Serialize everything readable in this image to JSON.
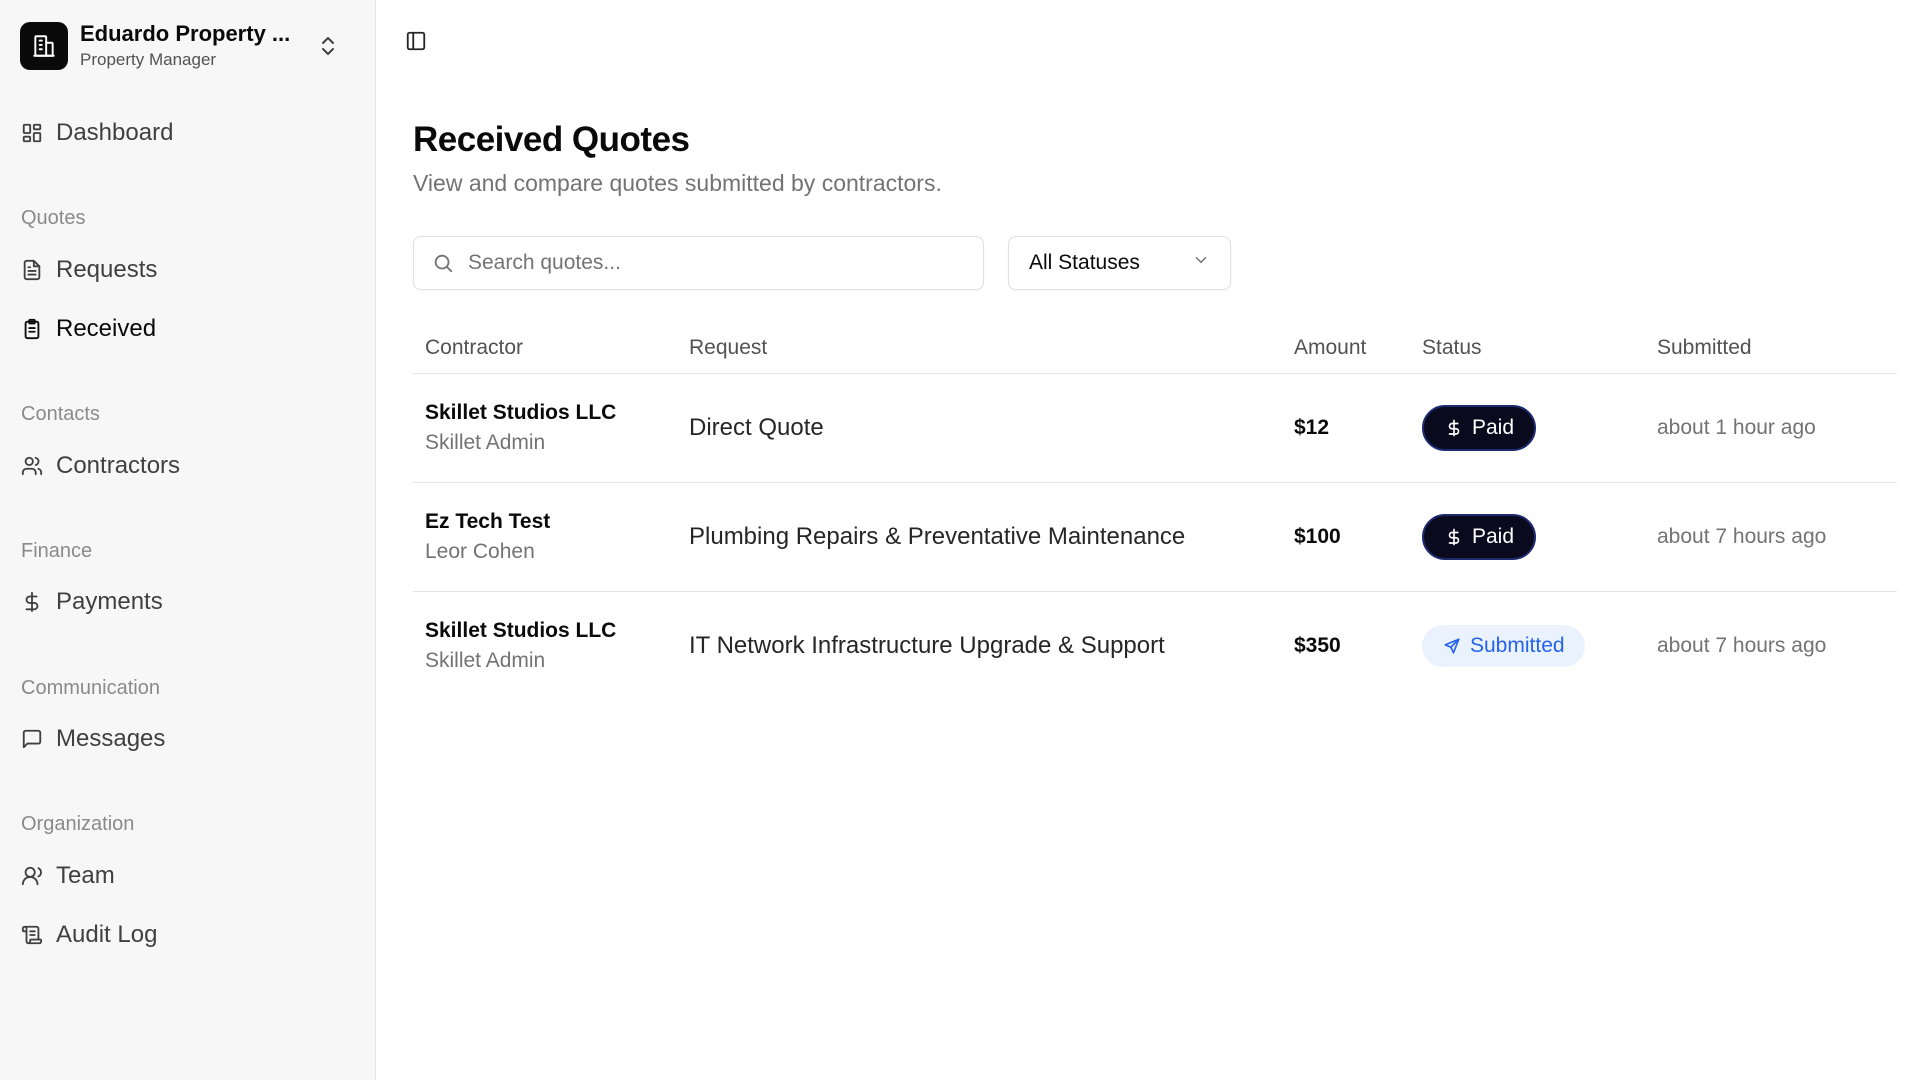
{
  "org": {
    "name": "Eduardo Property ...",
    "role": "Property Manager",
    "logo_icon": "building-icon",
    "switch_icon": "chevrons-up-down-icon"
  },
  "sidebar": {
    "dashboard": {
      "label": "Dashboard",
      "icon": "layout-grid-icon"
    },
    "sections": {
      "quotes": "Quotes",
      "contacts": "Contacts",
      "finance": "Finance",
      "communication": "Communication",
      "organization": "Organization"
    },
    "requests": {
      "label": "Requests",
      "icon": "file-text-icon"
    },
    "received": {
      "label": "Received",
      "icon": "clipboard-list-icon",
      "active": true
    },
    "contractors": {
      "label": "Contractors",
      "icon": "users-icon"
    },
    "payments": {
      "label": "Payments",
      "icon": "dollar-sign-icon"
    },
    "messages": {
      "label": "Messages",
      "icon": "message-square-icon"
    },
    "team": {
      "label": "Team",
      "icon": "user-icon"
    },
    "audit_log": {
      "label": "Audit Log",
      "icon": "scroll-text-icon"
    }
  },
  "header": {
    "toggle_icon": "panel-left-icon"
  },
  "page": {
    "title": "Received Quotes",
    "subtitle": "View and compare quotes submitted by contractors."
  },
  "filters": {
    "search_placeholder": "Search quotes...",
    "search_value": "",
    "status_selected": "All Statuses"
  },
  "table": {
    "headers": {
      "contractor": "Contractor",
      "request": "Request",
      "amount": "Amount",
      "status": "Status",
      "submitted": "Submitted"
    },
    "rows": [
      {
        "contractor": "Skillet Studios LLC",
        "contact": "Skillet Admin",
        "request": "Direct Quote",
        "amount": "$12",
        "status": "Paid",
        "submitted": "about 1 hour ago"
      },
      {
        "contractor": "Ez Tech Test",
        "contact": "Leor Cohen",
        "request": "Plumbing Repairs & Preventative Maintenance",
        "amount": "$100",
        "status": "Paid",
        "submitted": "about 7 hours ago"
      },
      {
        "contractor": "Skillet Studios LLC",
        "contact": "Skillet Admin",
        "request": "IT Network Infrastructure Upgrade & Support",
        "amount": "$350",
        "status": "Submitted",
        "submitted": "about 7 hours ago"
      }
    ]
  },
  "colors": {
    "paid_badge_bg": "#0a0a1f",
    "submitted_badge_bg": "#eaf2fe",
    "submitted_badge_text": "#2563eb"
  }
}
